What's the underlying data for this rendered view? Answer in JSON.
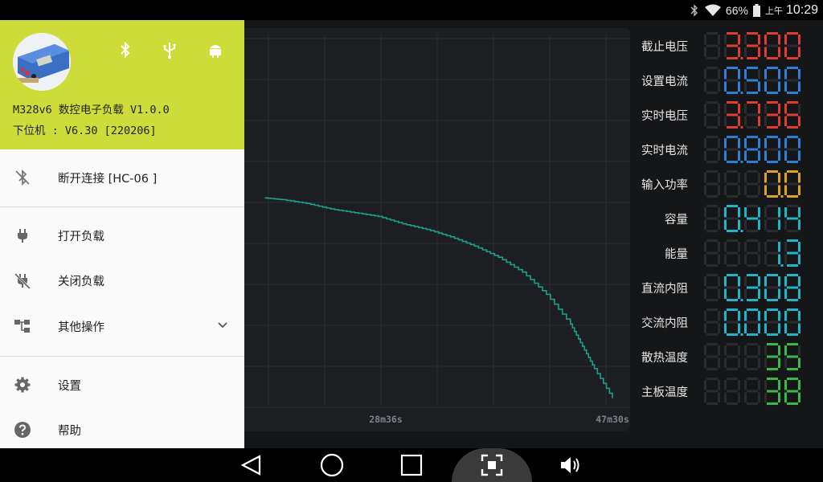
{
  "status_bar": {
    "battery_percent": "66%",
    "ampm": "上午",
    "time": "10:29",
    "icons": [
      "bluetooth-icon",
      "wifi-icon",
      "battery-icon"
    ]
  },
  "drawer": {
    "device_name": "M328v6 数控电子负载 V1.0.0",
    "firmware": "下位机 : V6.30 [220206]",
    "header_icons": [
      "bluetooth-icon",
      "usb-icon",
      "android-icon"
    ],
    "items": [
      {
        "label": "断开连接 [HC-06 ]",
        "icon": "bluetooth-disabled-icon"
      },
      {
        "label": "打开负载",
        "icon": "power-plug-icon"
      },
      {
        "label": "关闭负载",
        "icon": "power-plug-off-icon"
      },
      {
        "label": "其他操作",
        "icon": "hierarchy-icon"
      },
      {
        "label": "设置",
        "icon": "gear-icon"
      },
      {
        "label": "帮助",
        "icon": "help-icon"
      }
    ]
  },
  "readouts": [
    {
      "label": "截止电压",
      "value": "3.300",
      "color": "#e03c31"
    },
    {
      "label": "设置电流",
      "value": "0.500",
      "color": "#2d7fd6"
    },
    {
      "label": "实时电压",
      "value": "3.736",
      "color": "#e03c31"
    },
    {
      "label": "实时电流",
      "value": "0.800",
      "color": "#2d7fd6"
    },
    {
      "label": "输入功率",
      "value": "0.0",
      "color": "#e0a21c"
    },
    {
      "label": "容量",
      "value": "0.414",
      "color": "#1fb5c8"
    },
    {
      "label": "能量",
      "value": "1.3",
      "color": "#1fb5c8"
    },
    {
      "label": "直流内阻",
      "value": "0.308",
      "color": "#1fb5c8"
    },
    {
      "label": "交流内阻",
      "value": "0.000",
      "color": "#1fb5c8"
    },
    {
      "label": "散热温度",
      "value": "35",
      "color": "#3cb84a"
    },
    {
      "label": "主板温度",
      "value": "38",
      "color": "#3cb84a"
    }
  ],
  "chart_data": {
    "type": "line",
    "x_tick_labels": [
      "28m36s",
      "47m30s"
    ],
    "series": [
      {
        "color": "#1d9e86",
        "x_minutes": [
          18.5,
          20,
          22,
          24,
          26,
          28,
          30,
          32,
          34,
          36,
          38,
          40,
          42,
          44,
          45,
          46,
          47.5
        ],
        "y_rel": [
          0.56,
          0.555,
          0.545,
          0.53,
          0.52,
          0.51,
          0.49,
          0.475,
          0.455,
          0.43,
          0.4,
          0.36,
          0.3,
          0.22,
          0.16,
          0.1,
          0.02
        ]
      }
    ]
  },
  "navbar": {
    "buttons": [
      "back-icon",
      "home-icon",
      "recents-icon",
      "fullscreen-icon",
      "volume-icon"
    ]
  }
}
